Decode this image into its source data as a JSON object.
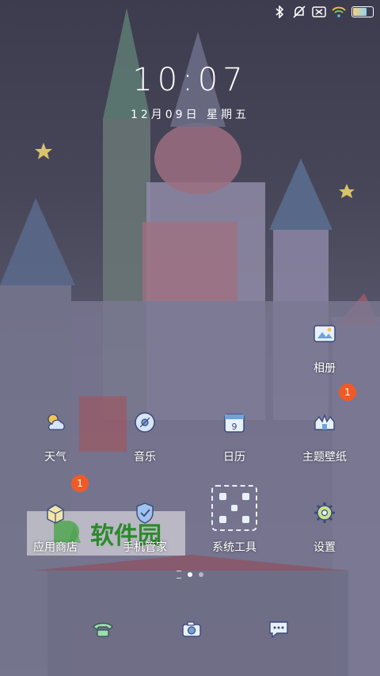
{
  "status_bar": {
    "icons": [
      "bluetooth-icon",
      "mute-icon",
      "sim-off-icon",
      "wifi-icon",
      "battery-icon"
    ],
    "battery_percent": 75,
    "battery_color": "#8fd3f4"
  },
  "lockscreen": {
    "time": "10:07",
    "date": "12月09日  星期五"
  },
  "apps": [
    {
      "label": "相册",
      "icon": "gallery-icon"
    },
    {
      "label": "天气",
      "icon": "weather-icon"
    },
    {
      "label": "音乐",
      "icon": "music-icon"
    },
    {
      "label": "日历",
      "icon": "calendar-icon",
      "day": "9"
    },
    {
      "label": "主题壁纸",
      "icon": "theme-icon"
    },
    {
      "label": "应用商店",
      "icon": "app-store-icon",
      "badge": "1"
    },
    {
      "label": "手机管家",
      "icon": "security-icon"
    },
    {
      "label": "系统工具",
      "icon": "folder-icon"
    },
    {
      "label": "设置",
      "icon": "settings-icon"
    }
  ],
  "gallery_badge": "1",
  "page_indicator": {
    "current": 1,
    "pages": 2
  },
  "dock": [
    {
      "icon": "phone-icon"
    },
    {
      "icon": "camera-icon"
    },
    {
      "icon": "messages-icon"
    }
  ],
  "watermark": {
    "text": "软件园"
  },
  "colors": {
    "badge": "#f05a26",
    "accent_green": "#2a8a2a"
  }
}
